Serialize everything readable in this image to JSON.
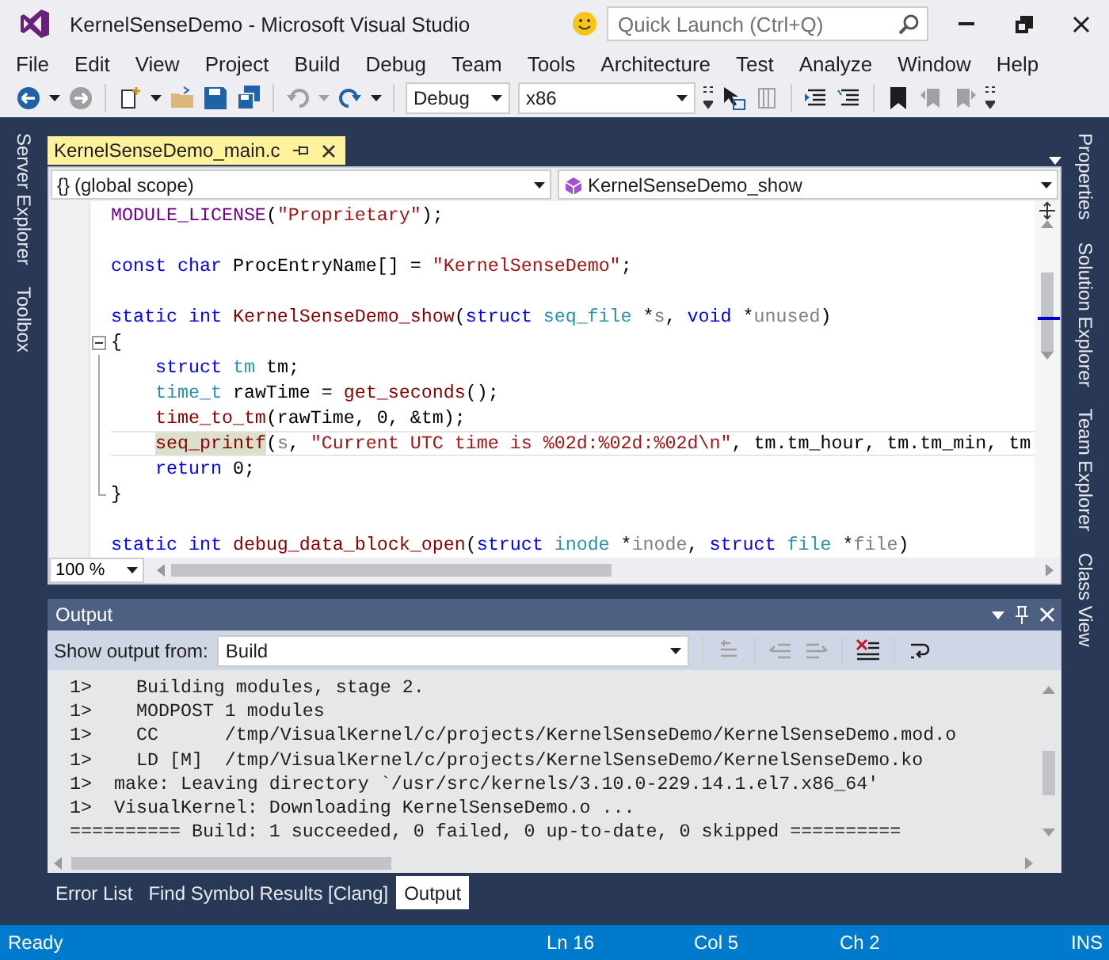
{
  "window": {
    "title": "KernelSenseDemo - Microsoft Visual Studio"
  },
  "quick_launch": {
    "placeholder": "Quick Launch (Ctrl+Q)"
  },
  "menu": [
    "File",
    "Edit",
    "View",
    "Project",
    "Build",
    "Debug",
    "Team",
    "Tools",
    "Architecture",
    "Test",
    "Analyze",
    "Window",
    "Help"
  ],
  "toolbar": {
    "configuration": "Debug",
    "platform": "x86"
  },
  "left_tool_tabs": [
    "Server Explorer",
    "Toolbox"
  ],
  "right_tool_tabs": [
    "Properties",
    "Solution Explorer",
    "Team Explorer",
    "Class View"
  ],
  "document_tabs": [
    {
      "label": "KernelSenseDemo_main.c",
      "selected": true
    }
  ],
  "navigation": {
    "scope_glyph": "{}",
    "scope": "(global scope)",
    "member": "KernelSenseDemo_show"
  },
  "code_lines": [
    {
      "kind": "code",
      "current": false,
      "tokens": [
        {
          "kind": "macro",
          "text": "MODULE_LICENSE"
        },
        {
          "kind": "plain",
          "text": "("
        },
        {
          "kind": "string",
          "text": "\"Proprietary\""
        },
        {
          "kind": "plain",
          "text": ");"
        }
      ]
    },
    {
      "kind": "blank"
    },
    {
      "kind": "code",
      "current": false,
      "tokens": [
        {
          "kind": "keyword",
          "text": "const "
        },
        {
          "kind": "keyword",
          "text": "char "
        },
        {
          "kind": "plain",
          "text": "ProcEntryName[] = "
        },
        {
          "kind": "string",
          "text": "\"KernelSenseDemo\""
        },
        {
          "kind": "plain",
          "text": ";"
        }
      ]
    },
    {
      "kind": "blank"
    },
    {
      "kind": "code",
      "current": false,
      "tokens": [
        {
          "kind": "keyword",
          "text": "static "
        },
        {
          "kind": "keyword",
          "text": "int "
        },
        {
          "kind": "function",
          "text": "KernelSenseDemo_show"
        },
        {
          "kind": "plain",
          "text": "("
        },
        {
          "kind": "keyword",
          "text": "struct "
        },
        {
          "kind": "type",
          "text": "seq_file"
        },
        {
          "kind": "plain",
          "text": " *"
        },
        {
          "kind": "param",
          "text": "s"
        },
        {
          "kind": "plain",
          "text": ", "
        },
        {
          "kind": "keyword",
          "text": "void "
        },
        {
          "kind": "plain",
          "text": "*"
        },
        {
          "kind": "param",
          "text": "unused"
        },
        {
          "kind": "plain",
          "text": ")"
        }
      ]
    },
    {
      "kind": "code",
      "current": false,
      "expanded": true,
      "tokens": [
        {
          "kind": "plain",
          "text": "{"
        }
      ],
      "children": [
        {
          "kind": "code",
          "current": false,
          "tokens": [
            {
              "kind": "keyword",
              "text": "    struct "
            },
            {
              "kind": "type",
              "text": "tm"
            },
            {
              "kind": "plain",
              "text": " tm;"
            }
          ]
        },
        {
          "kind": "code",
          "current": false,
          "tokens": [
            {
              "kind": "type",
              "text": "    time_t"
            },
            {
              "kind": "plain",
              "text": " rawTime = "
            },
            {
              "kind": "function",
              "text": "get_seconds"
            },
            {
              "kind": "plain",
              "text": "();"
            }
          ]
        },
        {
          "kind": "code",
          "current": false,
          "tokens": [
            {
              "kind": "function",
              "text": "    time_to_tm"
            },
            {
              "kind": "plain",
              "text": "(rawTime, 0, &tm);"
            }
          ]
        },
        {
          "kind": "code",
          "current": true,
          "tokens": [
            {
              "kind": "function",
              "text": "    seq_printf",
              "highlighted": true
            },
            {
              "kind": "plain",
              "text": "("
            },
            {
              "kind": "param",
              "text": "s"
            },
            {
              "kind": "plain",
              "text": ", "
            },
            {
              "kind": "string",
              "text": "\"Current UTC time is %02d:%02d:%02d\\n\""
            },
            {
              "kind": "plain",
              "text": ", tm.tm_hour, tm.tm_min, tm"
            }
          ]
        },
        {
          "kind": "code",
          "current": false,
          "tokens": [
            {
              "kind": "keyword",
              "text": "    return"
            },
            {
              "kind": "plain",
              "text": " 0;"
            }
          ]
        },
        {
          "kind": "code",
          "current": false,
          "tokens": [
            {
              "kind": "plain",
              "text": "}"
            }
          ]
        }
      ]
    },
    {
      "kind": "blank"
    },
    {
      "kind": "code",
      "current": false,
      "tokens": [
        {
          "kind": "keyword",
          "text": "static "
        },
        {
          "kind": "keyword",
          "text": "int "
        },
        {
          "kind": "function",
          "text": "debug_data_block_open"
        },
        {
          "kind": "plain",
          "text": "("
        },
        {
          "kind": "keyword",
          "text": "struct "
        },
        {
          "kind": "type",
          "text": "inode"
        },
        {
          "kind": "plain",
          "text": " *"
        },
        {
          "kind": "param",
          "text": "inode"
        },
        {
          "kind": "plain",
          "text": ", "
        },
        {
          "kind": "keyword",
          "text": "struct "
        },
        {
          "kind": "type",
          "text": "file"
        },
        {
          "kind": "plain",
          "text": " *"
        },
        {
          "kind": "param",
          "text": "file"
        },
        {
          "kind": "plain",
          "text": ")"
        }
      ]
    }
  ],
  "zoom": "100 %",
  "output": {
    "title": "Output",
    "source_label": "Show output from:",
    "source": "Build",
    "lines": [
      "1>    Building modules, stage 2.",
      "1>    MODPOST 1 modules",
      "1>    CC      /tmp/VisualKernel/c/projects/KernelSenseDemo/KernelSenseDemo.mod.o",
      "1>    LD [M]  /tmp/VisualKernel/c/projects/KernelSenseDemo/KernelSenseDemo.ko",
      "1>  make: Leaving directory `/usr/src/kernels/3.10.0-229.14.1.el7.x86_64'",
      "1>  VisualKernel: Downloading KernelSenseDemo.o ...",
      "========== Build: 1 succeeded, 0 failed, 0 up-to-date, 0 skipped =========="
    ]
  },
  "bottom_tabs": [
    {
      "label": "Error List",
      "selected": false
    },
    {
      "label": "Find Symbol Results [Clang]",
      "selected": false
    },
    {
      "label": "Output",
      "selected": true
    }
  ],
  "status_bar": {
    "state": "Ready",
    "line": "Ln 16",
    "column": "Col 5",
    "char": "Ch 2",
    "mode": "INS"
  }
}
